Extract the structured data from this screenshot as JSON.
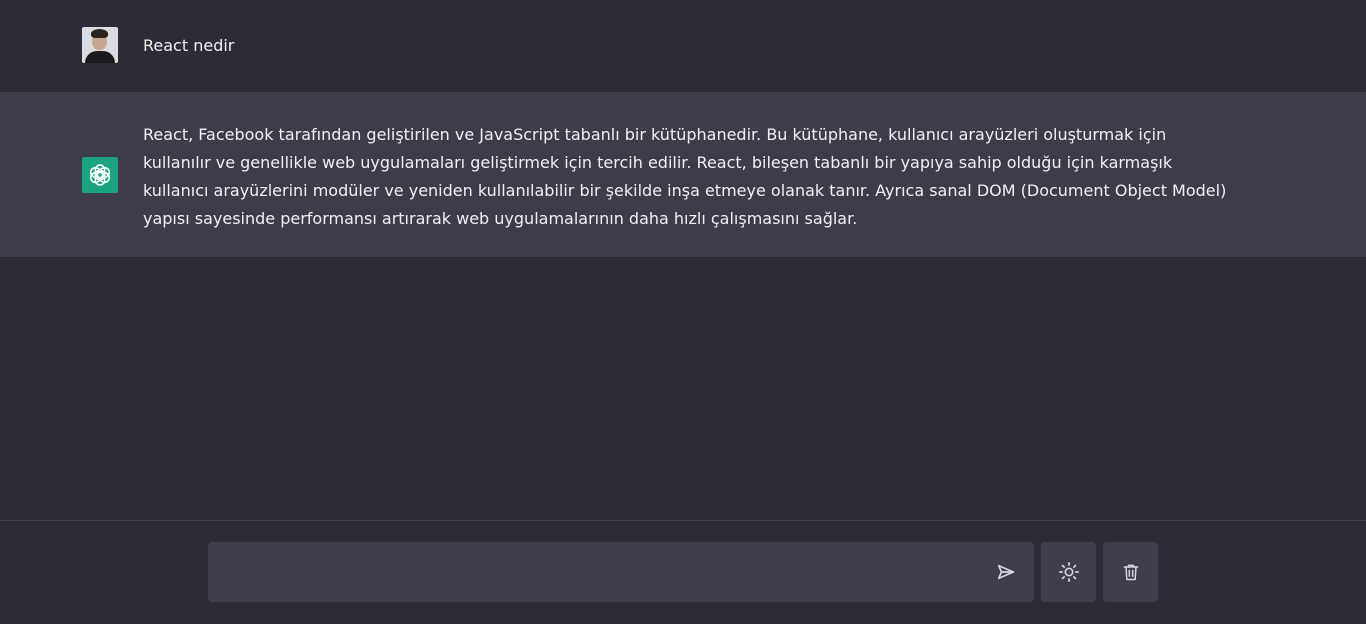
{
  "conversation": {
    "user_message": "React nedir",
    "bot_message": "React, Facebook tarafından geliştirilen ve JavaScript tabanlı bir kütüphanedir. Bu kütüphane, kullanıcı arayüzleri oluşturmak için kullanılır ve genellikle web uygulamaları geliştirmek için tercih edilir. React, bileşen tabanlı bir yapıya sahip olduğu için karmaşık kullanıcı arayüzlerini modüler ve yeniden kullanılabilir bir şekilde inşa etmeye olanak tanır. Ayrıca sanal DOM (Document Object Model) yapısı sayesinde performansı artırarak web uygulamalarının daha hızlı çalışmasını sağlar."
  },
  "composer": {
    "input_value": "",
    "input_placeholder": ""
  },
  "icons": {
    "user_avatar": "user-photo",
    "bot_avatar": "openai-logo-icon",
    "send": "send-icon",
    "theme": "sun-icon",
    "clear": "trash-icon"
  },
  "colors": {
    "page_background": "#2b2c35",
    "bot_row_background": "#3c3d48",
    "bot_avatar_background": "#19a37e",
    "control_background": "#3e3f4b"
  }
}
